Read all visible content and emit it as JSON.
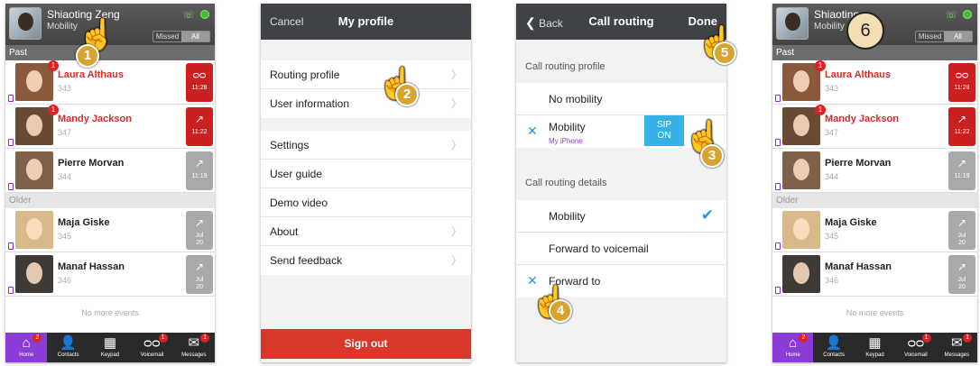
{
  "recents": {
    "user_name": "Shiaoting Zeng",
    "user_status": "Mobility",
    "user_name_short": "Shiaoting",
    "filters": [
      "Missed",
      "All"
    ],
    "sections": {
      "past": "Past",
      "older": "Older"
    },
    "contacts": [
      {
        "name": "Laura Althaus",
        "ext": "343",
        "missed": true,
        "badge": "1",
        "time": "11:28",
        "icon": "voicemail-icon",
        "face_color": "#8b5a3c"
      },
      {
        "name": "Mandy Jackson",
        "ext": "347",
        "missed": true,
        "badge": "1",
        "time": "11:22",
        "icon": "missed-call-icon",
        "face_color": "#6b4a35"
      },
      {
        "name": "Pierre Morvan",
        "ext": "344",
        "missed": false,
        "time": "11:19",
        "icon": "outgoing-call-icon",
        "face_color": "#7d6148"
      },
      {
        "name": "Maja Giske",
        "ext": "345",
        "missed": false,
        "time": "Jul\n20",
        "icon": "outgoing-call-icon",
        "face_color": "#d9b98a"
      },
      {
        "name": "Manaf Hassan",
        "ext": "346",
        "missed": false,
        "time": "Jul\n20",
        "icon": "outgoing-call-icon",
        "face_color": "#3f3a36"
      }
    ],
    "no_more_events": "No more events",
    "tabs": [
      {
        "label": "Home",
        "icon": "home-icon",
        "badge": "2"
      },
      {
        "label": "Contacts",
        "icon": "contacts-icon"
      },
      {
        "label": "Keypad",
        "icon": "keypad-icon"
      },
      {
        "label": "Voicemail",
        "icon": "voicemail-icon",
        "badge": "1"
      },
      {
        "label": "Messages",
        "icon": "messages-icon",
        "badge": "1"
      }
    ]
  },
  "profile": {
    "cancel": "Cancel",
    "title": "My profile",
    "group1": [
      "Routing profile",
      "User information"
    ],
    "group2": [
      "Settings",
      "User guide",
      "Demo video",
      "About",
      "Send feedback"
    ],
    "sign_out": "Sign out"
  },
  "routing": {
    "back": "Back",
    "title": "Call routing",
    "done": "Done",
    "profile_header": "Call routing profile",
    "no_mobility": "No mobility",
    "mobility": "Mobility",
    "mobility_sub": "My iPhone",
    "sip": "SIP",
    "sip_state": "ON",
    "details_header": "Call routing details",
    "details": [
      "Mobility",
      "Forward to voicemail",
      "Forward to"
    ]
  },
  "steps": [
    "1",
    "2",
    "3",
    "4",
    "5",
    "6"
  ],
  "colors": {
    "accent_purple": "#8b3bd6",
    "missed_red": "#e02a2a",
    "check_blue": "#2a94d6",
    "sign_out_red": "#d8372b",
    "step_gold": "#d9a42e"
  }
}
